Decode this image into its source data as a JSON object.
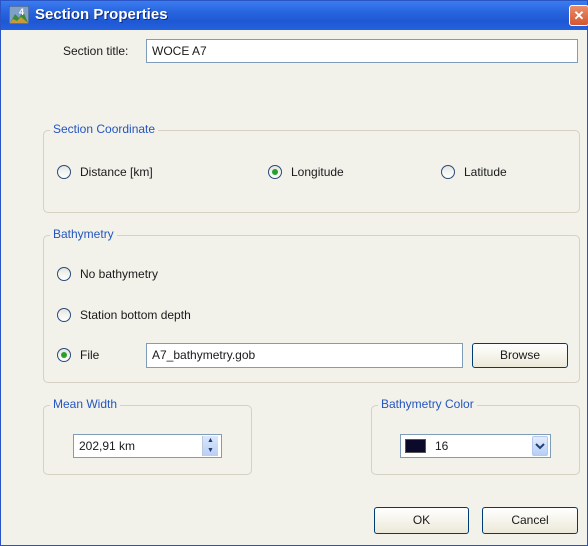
{
  "window": {
    "title": "Section Properties",
    "close_glyph": "✕"
  },
  "section_title": {
    "label": "Section title:",
    "value": "WOCE A7"
  },
  "section_coordinate": {
    "legend": "Section Coordinate",
    "options": [
      "Distance [km]",
      "Longitude",
      "Latitude"
    ],
    "selected": "Longitude"
  },
  "bathymetry": {
    "legend": "Bathymetry",
    "options": [
      "No bathymetry",
      "Station bottom depth",
      "File"
    ],
    "selected": "File",
    "file_value": "A7_bathymetry.gob",
    "browse_label": "Browse"
  },
  "mean_width": {
    "legend": "Mean Width",
    "value": "202,91 km"
  },
  "bathymetry_color": {
    "legend": "Bathymetry Color",
    "value": "16",
    "swatch_color": "#0b0a2a"
  },
  "buttons": {
    "ok": "OK",
    "cancel": "Cancel"
  },
  "icons": {
    "app": "app-icon",
    "spin_up": "▲",
    "spin_down": "▼",
    "dropdown": "▼"
  }
}
